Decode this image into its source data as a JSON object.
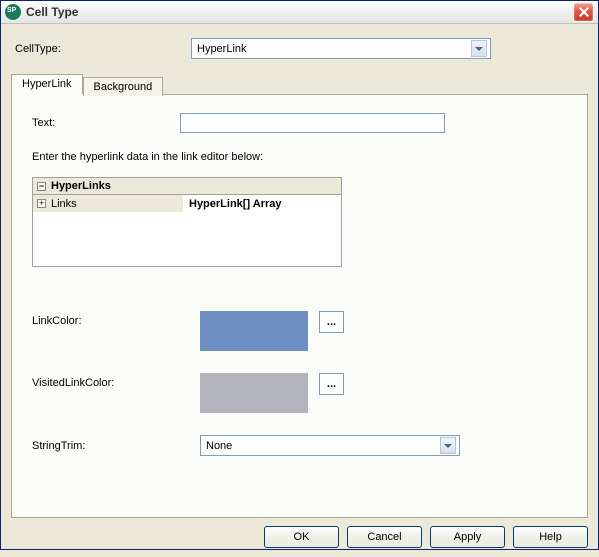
{
  "window": {
    "title": "Cell Type"
  },
  "cellType": {
    "label": "CellType:",
    "value": "HyperLink"
  },
  "tabs": {
    "hyperlink": "HyperLink",
    "background": "Background"
  },
  "panel": {
    "text_label": "Text:",
    "text_value": "",
    "instruction": "Enter the hyperlink data in the link editor below:",
    "grid": {
      "header": "HyperLinks",
      "row_label": "Links",
      "row_value": "HyperLink[] Array"
    },
    "linkcolor_label": "LinkColor:",
    "linkcolor_value": "#6d8fc2",
    "visitedcolor_label": "VisitedLinkColor:",
    "visitedcolor_value": "#b4b4bc",
    "stringtrim_label": "StringTrim:",
    "stringtrim_value": "None",
    "ellipsis": "..."
  },
  "buttons": {
    "ok": "OK",
    "cancel": "Cancel",
    "apply": "Apply",
    "help": "Help"
  }
}
